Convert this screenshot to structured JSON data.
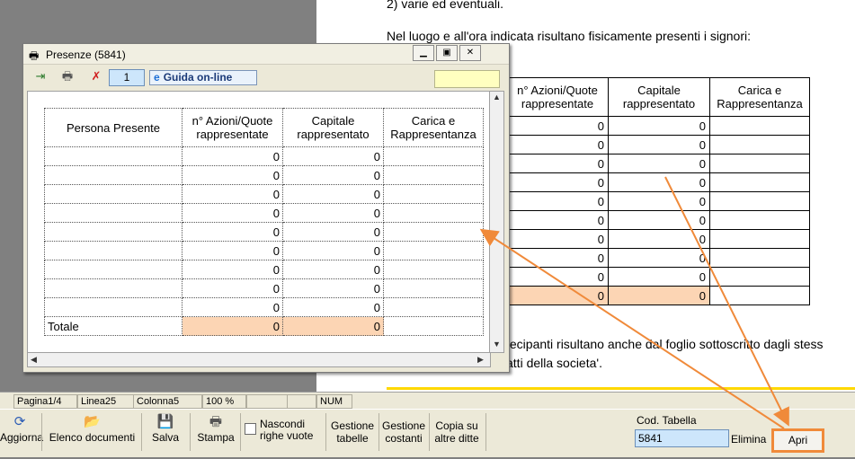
{
  "document": {
    "line1": "2) varie ed eventuali.",
    "line2": "Nel luogo e all'ora indicata risultano fisicamente presenti i signori:",
    "table_headers": [
      "n° Azioni/Quote rappresentate",
      "Capitale rappresentato",
      "Carica e Rappresentanza"
    ],
    "rows": [
      [
        "0",
        "0"
      ],
      [
        "0",
        "0"
      ],
      [
        "0",
        "0"
      ],
      [
        "0",
        "0"
      ],
      [
        "0",
        "0"
      ],
      [
        "0",
        "0"
      ],
      [
        "0",
        "0"
      ],
      [
        "0",
        "0"
      ],
      [
        "0",
        "0"
      ],
      [
        "0",
        "0"
      ]
    ],
    "text_after1": "tecipanti risultano anche dal foglio sottoscritto dagli stess",
    "text_after2": "atti della societa'."
  },
  "window": {
    "title": "Presenze (5841)",
    "page_value": "1",
    "guida_label": "Guida on-line",
    "headers": [
      "Persona Presente",
      "n° Azioni/Quote rappresentate",
      "Capitale rappresentato",
      "Carica e Rappresentanza"
    ],
    "rows": [
      [
        "",
        "0",
        "0",
        ""
      ],
      [
        "",
        "0",
        "0",
        ""
      ],
      [
        "",
        "0",
        "0",
        ""
      ],
      [
        "",
        "0",
        "0",
        ""
      ],
      [
        "",
        "0",
        "0",
        ""
      ],
      [
        "",
        "0",
        "0",
        ""
      ],
      [
        "",
        "0",
        "0",
        ""
      ],
      [
        "",
        "0",
        "0",
        ""
      ],
      [
        "",
        "0",
        "0",
        ""
      ]
    ],
    "total_label": "Totale",
    "total_values": [
      "0",
      "0"
    ]
  },
  "status": {
    "page": "Pagina1/4",
    "line": "Linea25",
    "column": "Colonna5",
    "zoom": "100 %",
    "num": "NUM"
  },
  "bottom": {
    "aggiorna": "Aggiorna",
    "elenco": "Elenco documenti",
    "salva": "Salva",
    "stampa": "Stampa",
    "nascondi_1": "Nascondi",
    "nascondi_2": "righe vuote",
    "gestione_tabelle_1": "Gestione",
    "gestione_tabelle_2": "tabelle",
    "gestione_costanti_1": "Gestione",
    "gestione_costanti_2": "costanti",
    "copia_1": "Copia su",
    "copia_2": "altre ditte",
    "cod_label": "Cod. Tabella",
    "cod_value": "5841",
    "elimina": "Elimina",
    "apri": "Apri"
  },
  "colors": {
    "highlight": "#fcd5b4",
    "annotation": "#f08a3a",
    "yellow_line": "#ffd800"
  }
}
